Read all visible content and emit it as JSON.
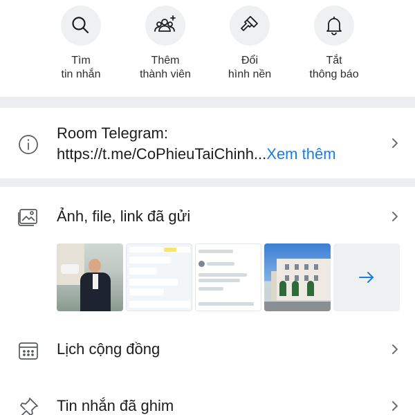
{
  "quick_actions": [
    {
      "icon": "search-icon",
      "line1": "Tìm",
      "line2": "tin nhắn"
    },
    {
      "icon": "add-member-icon",
      "line1": "Thêm",
      "line2": "thành viên"
    },
    {
      "icon": "paint-brush-icon",
      "line1": "Đổi",
      "line2": "hình nền"
    },
    {
      "icon": "bell-icon",
      "line1": "Tắt",
      "line2": "thông báo"
    }
  ],
  "info": {
    "icon": "info-icon",
    "line1": "Room Telegram:",
    "line2": "https://t.me/CoPhieuTaiChinh...",
    "more_label": "Xem thêm"
  },
  "media": {
    "icon": "image-icon",
    "title": "Ảnh, file, link đã gửi",
    "thumbnails": [
      "photo-person",
      "chat-screenshot",
      "post-screenshot",
      "building-photo"
    ],
    "more_icon": "arrow-right-icon"
  },
  "calendar": {
    "icon": "calendar-icon",
    "title": "Lịch cộng đồng"
  },
  "pinned": {
    "icon": "pin-icon",
    "title": "Tin nhắn đã ghim"
  },
  "colors": {
    "accent": "#1a7ae6",
    "band": "#eceef1",
    "circle": "#eef0f2"
  }
}
